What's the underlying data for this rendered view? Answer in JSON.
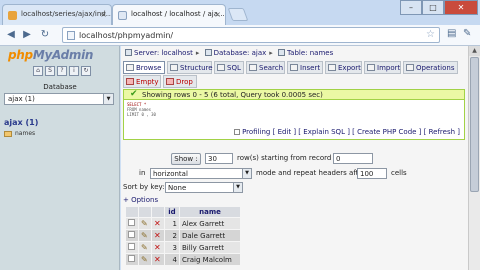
{
  "browser": {
    "tabs": [
      {
        "title": "localhost/series/ajax/ind..."
      },
      {
        "title": "localhost / localhost / aja..."
      }
    ],
    "address": "localhost/phpmyadmin/",
    "window_buttons": {
      "minimize": "–",
      "maximize": "□",
      "close": "✕"
    }
  },
  "left": {
    "logo_php": "php",
    "logo_rest": "MyAdmin",
    "database_label": "Database",
    "database_value": "ajax (1)",
    "db_link": "ajax (1)",
    "tables": [
      "names"
    ]
  },
  "breadcrumb": {
    "server_label": "Server:",
    "server": "localhost",
    "db_label": "Database:",
    "db": "ajax",
    "table_label": "Table:",
    "table": "names"
  },
  "tabs_primary": [
    "Browse",
    "Structure",
    "SQL",
    "Search",
    "Insert",
    "Export",
    "Import",
    "Operations"
  ],
  "tabs_secondary": [
    "Empty",
    "Drop"
  ],
  "result": {
    "message": "Showing rows 0 - 5 (6 total, Query took 0.0005 sec)",
    "sql_lines": [
      "SELECT *",
      "FROM names",
      "LIMIT 0 , 30"
    ],
    "links": [
      "Profiling",
      "Edit",
      "Explain SQL",
      "Create PHP Code",
      "Refresh"
    ]
  },
  "controls": {
    "show_button": "Show :",
    "rows_value": "30",
    "rows_label": "row(s) starting from record #",
    "start_value": "0",
    "in_label": "in",
    "mode_value": "horizontal",
    "repeat_label": "mode and repeat headers after",
    "repeat_value": "100",
    "cells_label": "cells",
    "sort_label": "Sort by key:",
    "sort_value": "None",
    "options_link": "+ Options"
  },
  "table": {
    "headers": [
      "id",
      "name"
    ],
    "rows": [
      {
        "id": "1",
        "name": "Alex Garrett"
      },
      {
        "id": "2",
        "name": "Dale Garrett"
      },
      {
        "id": "3",
        "name": "Billy Garrett"
      },
      {
        "id": "4",
        "name": "Craig Malcolm"
      }
    ]
  }
}
